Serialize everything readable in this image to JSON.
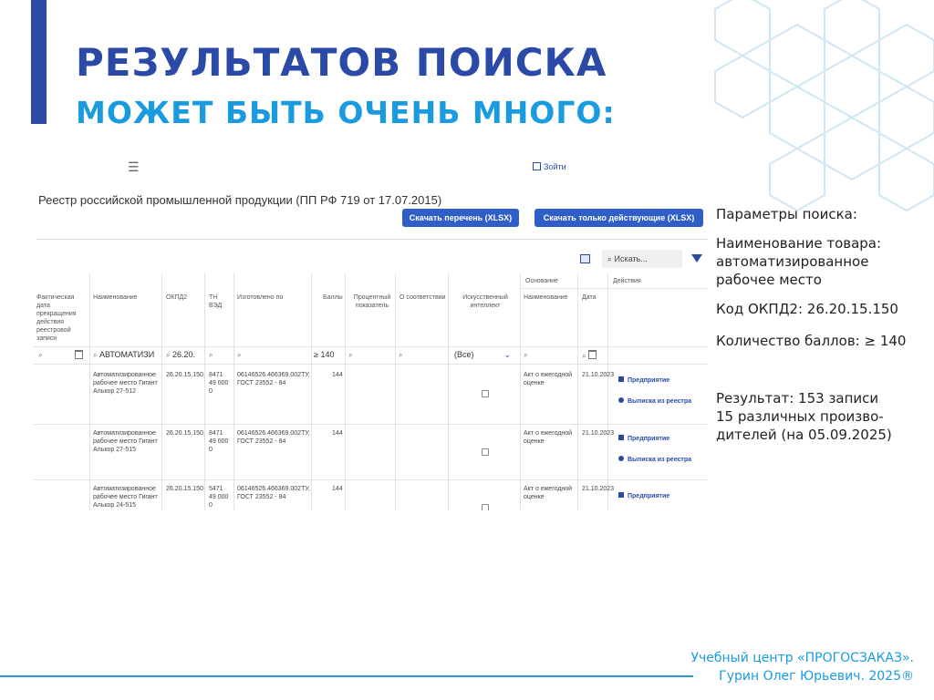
{
  "slide": {
    "title_line1": "РЕЗУЛЬТАТОВ ПОИСКА",
    "title_line2": "МОЖЕТ БЫТЬ ОЧЕНЬ МНОГО:",
    "accent_color": "#2b4aa8",
    "secondary_color": "#1a9be0"
  },
  "screenshot": {
    "login_label": "Зойти",
    "registry_title": "Реестр российской промышленной продукции (ПП РФ 719 от 17.07.2015)",
    "btn_download_list": "Скачать перечень (XLSX)",
    "btn_download_active": "Скачать только действующие (XLSX)",
    "search_placeholder": "Искать...",
    "group_headers": {
      "basis": "Основание",
      "action": "Действия"
    },
    "columns": [
      "Фактическая дата прекращения действия реестровой записи",
      "Наименование",
      "ОКПД2",
      "ТН ВЭД",
      "Изготовлено по",
      "Баллы",
      "Процентный показатель",
      "О соответствии",
      "Искусственный интеллект",
      "Наименование",
      "Дата"
    ],
    "filters": {
      "name": "АВТОМАТИЗИ",
      "okpd": "26.20.",
      "score": "140",
      "ai": "(Все)"
    },
    "rows": [
      {
        "name": "Автоматизированное рабочее место Гигант Алькор 27-512",
        "okpd": "26.20.15.150",
        "tnved": "8471 49 000 0",
        "made_by": "06146526.466369.002ТУ, ГОСТ 23552 - 84",
        "score": "144",
        "basis": "Акт о ежегодной оценке",
        "date": "21.10.2023",
        "link1": "Предприятие",
        "link2": "Выписка из реестра"
      },
      {
        "name": "Автоматизированное рабочее место Гигант Алькор 27-515",
        "okpd": "26.20.15.150",
        "tnved": "8471 49 000 0",
        "made_by": "06146526.466369.002ТУ, ГОСТ 23552 - 84",
        "score": "144",
        "basis": "Акт о ежегодной оценке",
        "date": "21.10.2023",
        "link1": "Предприятие",
        "link2": "Выписка из реестра"
      },
      {
        "name": "Автоматизированное рабочее место Гигант Алькор 24-515",
        "okpd": "26.20.15.150",
        "tnved": "5471 49 000 0",
        "made_by": "06146526.466369.002ТУ, ГОСТ 23552 - 84",
        "score": "144",
        "basis": "Акт о ежегодной оценке",
        "date": "21.10.2023",
        "link1": "Предприятие"
      }
    ]
  },
  "params": {
    "heading": "Параметры поиска:",
    "product_label": "Наименование товара:",
    "product_value": "автоматизированное рабочее место",
    "okpd": "Код ОКПД2: 26.20.15.150",
    "score": "Количество баллов: ≥ 140",
    "result_line1": "Результат: 153 записи",
    "result_line2": "15 различных произво-",
    "result_line3": "дителей (на 05.09.2025)"
  },
  "footer": {
    "line1": "Учебный центр «ПРОГОСЗАКАЗ».",
    "line2": "Гурин Олег Юрьевич. 2025®"
  }
}
